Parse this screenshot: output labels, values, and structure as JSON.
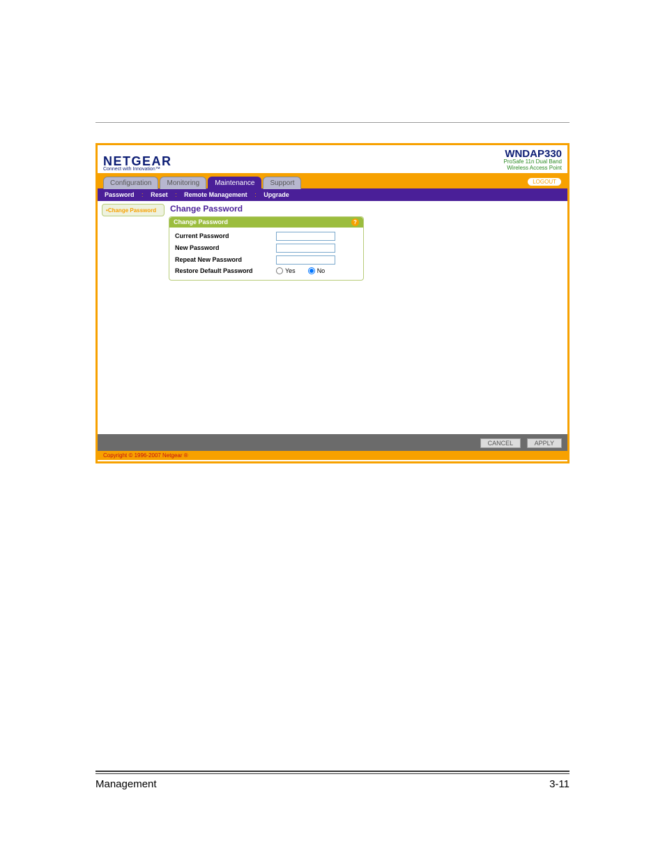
{
  "brand": {
    "name": "NETGEAR",
    "tagline": "Connect with Innovation™"
  },
  "model": {
    "name": "WNDAP330",
    "sub1": "ProSafe 11n Dual Band",
    "sub2": "Wireless Access Point"
  },
  "tabs": {
    "configuration": "Configuration",
    "monitoring": "Monitoring",
    "maintenance": "Maintenance",
    "support": "Support"
  },
  "logout": "LOGOUT",
  "subnav": {
    "password": "Password",
    "reset": "Reset",
    "remote": "Remote Management",
    "upgrade": "Upgrade"
  },
  "side_tab": "Change Password",
  "pane_title": "Change Password",
  "card": {
    "header": "Change Password",
    "fields": {
      "current": "Current Password",
      "new": "New Password",
      "repeat": "Repeat New Password",
      "restore": "Restore Default Password"
    },
    "radio": {
      "yes": "Yes",
      "no": "No"
    }
  },
  "footer": {
    "cancel": "CANCEL",
    "apply": "APPLY"
  },
  "copyright": "Copyright © 1996-2007 Netgear ®",
  "page_footer": {
    "left": "Management",
    "right": "3-11"
  }
}
